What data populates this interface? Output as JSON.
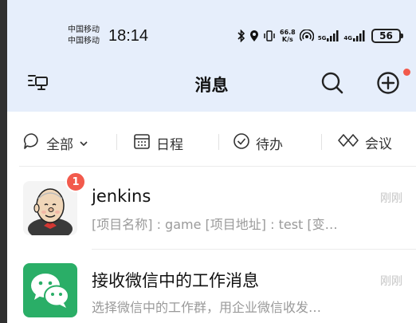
{
  "status_bar": {
    "carrier_1": "中国移动",
    "carrier_2": "中国移动",
    "time": "18:14",
    "net_speed_value": "66.8",
    "net_speed_unit": "K/s",
    "signal_1_label": "5G",
    "signal_2_label": "4G",
    "battery": "56"
  },
  "header": {
    "title": "消息"
  },
  "filters": [
    {
      "label": "全部"
    },
    {
      "label": "日程"
    },
    {
      "label": "待办"
    },
    {
      "label": "会议"
    }
  ],
  "messages": [
    {
      "title": "jenkins",
      "preview": "[项目名称] : game [项目地址] : test [变…",
      "time": "刚刚",
      "badge": "1"
    },
    {
      "title": "接收微信中的工作消息",
      "preview": "选择微信中的工作群，用企业微信收发…",
      "time": "刚刚"
    }
  ],
  "colors": {
    "header_bg": "#e6eefb",
    "badge_red": "#f25a4c",
    "wechat_green": "#2aae67"
  }
}
